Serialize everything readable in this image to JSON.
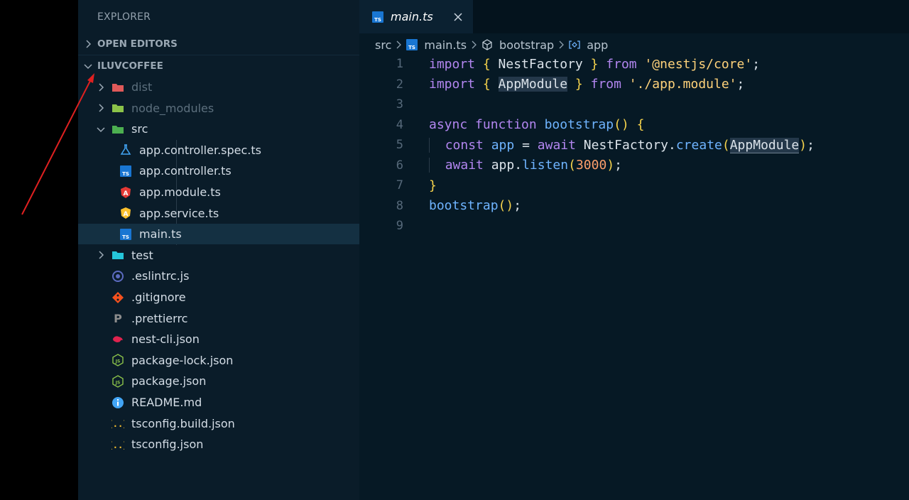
{
  "sidebar": {
    "title": "EXPLORER",
    "open_editors": "OPEN EDITORS",
    "project": "ILUVCOFFEE",
    "tree": [
      {
        "label": "dist",
        "kind": "folder",
        "icon": "folder-dist-icon",
        "color": "#e05a5a",
        "expanded": false,
        "depth": 1,
        "dim": true
      },
      {
        "label": "node_modules",
        "kind": "folder",
        "icon": "folder-node-icon",
        "color": "#8bc34a",
        "expanded": false,
        "depth": 1,
        "dim": true
      },
      {
        "label": "src",
        "kind": "folder",
        "icon": "folder-src-icon",
        "color": "#4caf50",
        "expanded": true,
        "depth": 1,
        "dim": false
      },
      {
        "label": "app.controller.spec.ts",
        "kind": "file",
        "icon": "flask-icon",
        "color": "#42a5f5",
        "depth": 2
      },
      {
        "label": "app.controller.ts",
        "kind": "file",
        "icon": "typescript-icon",
        "color": "#1976d2",
        "depth": 2
      },
      {
        "label": "app.module.ts",
        "kind": "file",
        "icon": "angular-red-icon",
        "color": "#e53935",
        "depth": 2
      },
      {
        "label": "app.service.ts",
        "kind": "file",
        "icon": "angular-yellow-icon",
        "color": "#fbc02d",
        "depth": 2
      },
      {
        "label": "main.ts",
        "kind": "file",
        "icon": "typescript-icon",
        "color": "#1976d2",
        "depth": 2,
        "active": true
      },
      {
        "label": "test",
        "kind": "folder",
        "icon": "folder-test-icon",
        "color": "#26c6da",
        "expanded": false,
        "depth": 1,
        "dim": false
      },
      {
        "label": ".eslintrc.js",
        "kind": "file",
        "icon": "eslint-icon",
        "color": "#5c6bc0",
        "depth": 1
      },
      {
        "label": ".gitignore",
        "kind": "file",
        "icon": "git-icon",
        "color": "#f4511e",
        "depth": 1
      },
      {
        "label": ".prettierrc",
        "kind": "file",
        "icon": "prettier-icon",
        "color": "#8d8d8d",
        "depth": 1
      },
      {
        "label": "nest-cli.json",
        "kind": "file",
        "icon": "nest-icon",
        "color": "#e0234e",
        "depth": 1
      },
      {
        "label": "package-lock.json",
        "kind": "file",
        "icon": "nodejs-icon",
        "color": "#8bc34a",
        "depth": 1
      },
      {
        "label": "package.json",
        "kind": "file",
        "icon": "nodejs-icon",
        "color": "#8bc34a",
        "depth": 1
      },
      {
        "label": "README.md",
        "kind": "file",
        "icon": "info-icon",
        "color": "#42a5f5",
        "depth": 1
      },
      {
        "label": "tsconfig.build.json",
        "kind": "file",
        "icon": "json-braces-icon",
        "color": "#fbc02d",
        "depth": 1
      },
      {
        "label": "tsconfig.json",
        "kind": "file",
        "icon": "json-braces-icon",
        "color": "#fbc02d",
        "depth": 1
      }
    ]
  },
  "editor": {
    "tab": {
      "label": "main.ts",
      "icon": "typescript-icon"
    },
    "breadcrumb": {
      "src": "src",
      "file": "main.ts",
      "func": "bootstrap",
      "var": "app"
    },
    "lines": [
      [
        [
          "k",
          "import "
        ],
        [
          "b",
          "{ "
        ],
        [
          "p",
          "NestFactory "
        ],
        [
          "b",
          "} "
        ],
        [
          "k",
          "from "
        ],
        [
          "s",
          "'@nestjs/core'"
        ],
        [
          "p",
          ";"
        ]
      ],
      [
        [
          "k",
          "import "
        ],
        [
          "b",
          "{ "
        ],
        [
          "hl",
          "AppModule"
        ],
        [
          "b",
          " } "
        ],
        [
          "k",
          "from "
        ],
        [
          "s",
          "'./app.module'"
        ],
        [
          "p",
          ";"
        ]
      ],
      [],
      [
        [
          "k",
          "async function "
        ],
        [
          "f",
          "bootstrap"
        ],
        [
          "b",
          "() {"
        ]
      ],
      [
        [
          "ind",
          "  "
        ],
        [
          "k",
          "const "
        ],
        [
          "f",
          "app "
        ],
        [
          "p",
          "= "
        ],
        [
          "k",
          "await "
        ],
        [
          "p",
          "NestFactory."
        ],
        [
          "f",
          "create"
        ],
        [
          "b",
          "("
        ],
        [
          "hlul",
          "AppModule"
        ],
        [
          "b",
          ")"
        ],
        [
          "p",
          ";"
        ]
      ],
      [
        [
          "ind",
          "  "
        ],
        [
          "k",
          "await "
        ],
        [
          "p",
          "app."
        ],
        [
          "f",
          "listen"
        ],
        [
          "b",
          "("
        ],
        [
          "n",
          "3000"
        ],
        [
          "b",
          ")"
        ],
        [
          "p",
          ";"
        ]
      ],
      [
        [
          "b",
          "}"
        ]
      ],
      [
        [
          "f",
          "bootstrap"
        ],
        [
          "b",
          "()"
        ],
        [
          "p",
          ";"
        ]
      ],
      []
    ]
  },
  "colors": {
    "sidebar_bg": "#0a1c29",
    "editor_bg": "#061925",
    "annotation_arrow": "#e02020"
  }
}
